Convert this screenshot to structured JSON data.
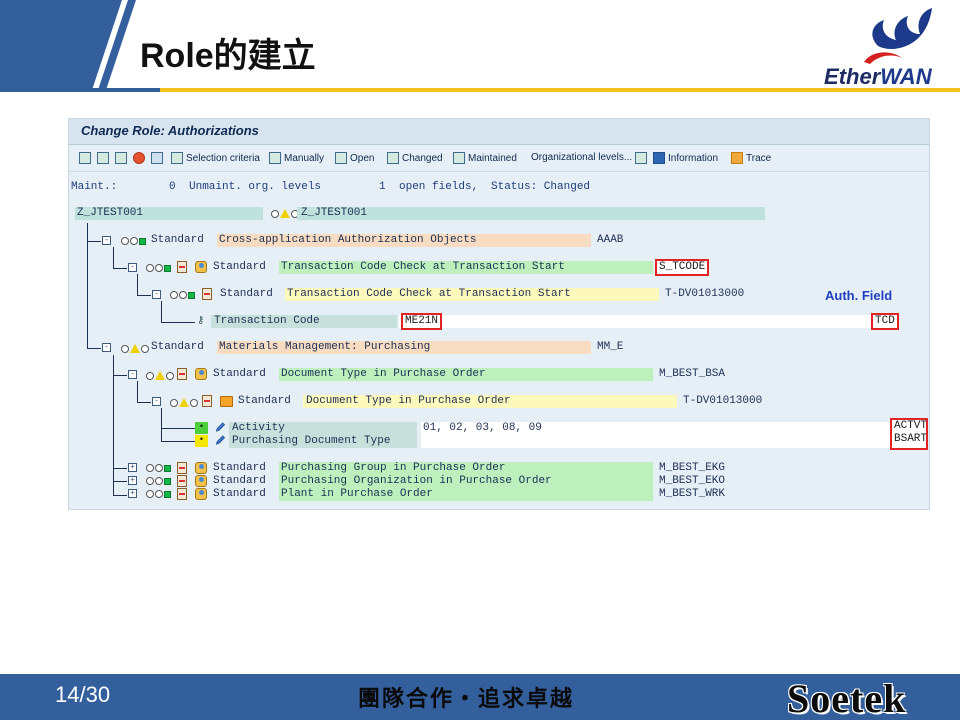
{
  "slide": {
    "title": "Role的建立",
    "page": "14/30",
    "slogan": "團隊合作・追求卓越",
    "logo_top_prefix": "E",
    "logo_top_mid": "ther",
    "logo_top_suffix": "WAN",
    "logo_bottom": "Soetek",
    "colors": {
      "band": "#33609c",
      "gold": "#f4c21a"
    }
  },
  "sap": {
    "window_title": "Change Role: Authorizations",
    "toolbar": {
      "selection_criteria": "Selection criteria",
      "manually": "Manually",
      "open": "Open",
      "changed": "Changed",
      "maintained": "Maintained",
      "org_levels": "Organizational levels...",
      "information": "Information",
      "trace": "Trace"
    },
    "status": {
      "maint_label": "Maint.:",
      "unmaint_count": "0",
      "unmaint_label": "Unmaint. org. levels",
      "open_count": "1",
      "open_label": "open fields,",
      "status_text": "Status: Changed"
    },
    "annotation": "Auth. Field",
    "tree": {
      "root_left": "Z_JTEST001",
      "root_right": "Z_JTEST001",
      "l1a": {
        "type": "Standard",
        "text": "Cross-application Authorization Objects",
        "code": "AAAB"
      },
      "l2a": {
        "type": "Standard",
        "text": "Transaction Code Check at Transaction Start",
        "code": "S_TCODE"
      },
      "l3a": {
        "type": "Standard",
        "text": "Transaction Code Check at Transaction Start",
        "code": "T-DV01013000"
      },
      "l4a": {
        "label": "Transaction Code",
        "value": "ME21N",
        "field": "TCD"
      },
      "l1b": {
        "type": "Standard",
        "text": "Materials Management: Purchasing",
        "code": "MM_E"
      },
      "l2b": {
        "type": "Standard",
        "text": "Document Type in Purchase Order",
        "code": "M_BEST_BSA"
      },
      "l3b": {
        "type": "Standard",
        "text": "Document Type in Purchase Order",
        "code": "T-DV01013000"
      },
      "l4b": {
        "label": "Activity",
        "value": "01, 02, 03, 08, 09",
        "field": "ACTVT"
      },
      "l4c": {
        "label": "Purchasing Document Type",
        "value": "",
        "field": "BSART"
      },
      "l2c": {
        "type": "Standard",
        "text": "Purchasing Group in Purchase Order",
        "code": "M_BEST_EKG"
      },
      "l2d": {
        "type": "Standard",
        "text": "Purchasing Organization in Purchase Order",
        "code": "M_BEST_EKO"
      },
      "l2e": {
        "type": "Standard",
        "text": "Plant in Purchase Order",
        "code": "M_BEST_WRK"
      }
    }
  }
}
